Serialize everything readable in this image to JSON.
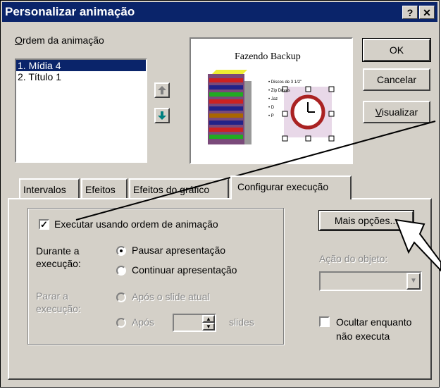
{
  "window": {
    "title": "Personalizar animação",
    "help_btn": "?",
    "close_btn": "✕"
  },
  "order": {
    "label": "Ordem da animação",
    "items": [
      "1. Mídia 4",
      "2. Título 1"
    ]
  },
  "buttons": {
    "ok": "OK",
    "cancel": "Cancelar",
    "preview": "Visualizar"
  },
  "preview": {
    "slide_title": "Fazendo Backup",
    "bullets": [
      "Discos de 3 1/2\"",
      "Zip Drives",
      "Jaz",
      "D",
      "P"
    ]
  },
  "tabs": [
    "Intervalos",
    "Efeitos",
    "Efeitos do gráfico",
    "Configurar execução"
  ],
  "exec": {
    "checkbox_label": "Executar usando ordem de animação",
    "checkbox_checked": true,
    "during_label": "Durante a execução:",
    "pause": "Pausar apresentação",
    "continue": "Continuar apresentação",
    "stop_label": "Parar a execução:",
    "after_current": "Após o slide atual",
    "after": "Após",
    "slides": "slides"
  },
  "right": {
    "more_options": "Mais opções...",
    "object_action_label": "Ação do objeto:",
    "hide_label": "Ocultar enquanto não executa"
  },
  "colors": {
    "titlebar": "#0a246a",
    "face": "#d4d0c8"
  }
}
